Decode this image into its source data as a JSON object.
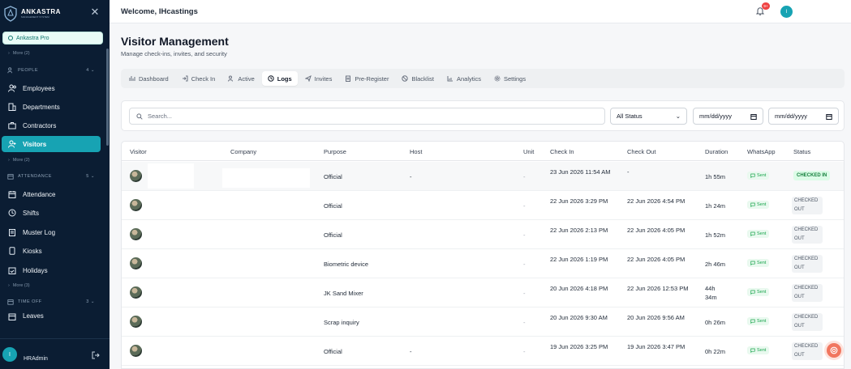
{
  "sidebar": {
    "brand": "ANKASTRA",
    "brand_tagline": "MANAGEMENT SYSTEM",
    "plan": "Ankastra Pro",
    "more_top": "More (2)",
    "people": {
      "label": "PEOPLE",
      "count": "4"
    },
    "people_items": [
      "Employees",
      "Departments",
      "Contractors",
      "Visitors"
    ],
    "more_people": "More (2)",
    "attendance": {
      "label": "ATTENDANCE",
      "count": "5"
    },
    "attendance_items": [
      "Attendance",
      "Shifts",
      "Muster Log",
      "Kiosks",
      "Holidays"
    ],
    "more_attendance": "More (3)",
    "time_off": {
      "label": "TIME OFF",
      "count": "3"
    },
    "time_off_items": [
      "Leaves"
    ],
    "user": {
      "initial": "I",
      "name": "HRAdmin"
    }
  },
  "topbar": {
    "welcome": "Welcome, IHcastings",
    "notif_badge": "9+",
    "avatar_initial": "I"
  },
  "page": {
    "title": "Visitor Management",
    "subtitle": "Manage check-ins, invites, and security"
  },
  "tabs": [
    "Dashboard",
    "Check In",
    "Active",
    "Logs",
    "Invites",
    "Pre-Register",
    "Blacklist",
    "Analytics",
    "Settings"
  ],
  "filters": {
    "search_placeholder": "Search...",
    "status_value": "All Status",
    "date_from": "mm/dd/yyyy",
    "date_to": "mm/dd/yyyy"
  },
  "table": {
    "headers": [
      "Visitor",
      "Company",
      "Purpose",
      "Host",
      "Unit",
      "Check In",
      "Check Out",
      "Duration",
      "WhatsApp",
      "Status"
    ],
    "rows": [
      {
        "purpose": "Official",
        "host": "-",
        "unit": "-",
        "check_in": "23 Jun 2026 11:54 AM",
        "check_out": "-",
        "duration": "1h 55m",
        "whatsapp": "Sent",
        "status": "CHECKED IN"
      },
      {
        "purpose": "Official",
        "host": "",
        "unit": "-",
        "check_in": "22 Jun 2026 3:29 PM",
        "check_out": "22 Jun 2026 4:54 PM",
        "duration": "1h 24m",
        "whatsapp": "Sent",
        "status": "CHECKED OUT"
      },
      {
        "purpose": "Official",
        "host": "",
        "unit": "-",
        "check_in": "22 Jun 2026 2:13 PM",
        "check_out": "22 Jun 2026 4:05 PM",
        "duration": "1h 52m",
        "whatsapp": "Sent",
        "status": "CHECKED OUT"
      },
      {
        "purpose": "Biometric device",
        "host": "",
        "unit": "-",
        "check_in": "22 Jun 2026 1:19 PM",
        "check_out": "22 Jun 2026 4:05 PM",
        "duration": "2h 46m",
        "whatsapp": "Sent",
        "status": "CHECKED OUT"
      },
      {
        "purpose": "JK Sand Mixer",
        "host": "",
        "unit": "-",
        "check_in": "20 Jun 2026 4:18 PM",
        "check_out": "22 Jun 2026 12:53 PM",
        "duration": "44h 34m",
        "whatsapp": "Sent",
        "status": "CHECKED OUT"
      },
      {
        "purpose": "Scrap inquiry",
        "host": "",
        "unit": "-",
        "check_in": "20 Jun 2026 9:30 AM",
        "check_out": "20 Jun 2026 9:56 AM",
        "duration": "0h 26m",
        "whatsapp": "Sent",
        "status": "CHECKED OUT"
      },
      {
        "purpose": "Official",
        "host": "-",
        "unit": "-",
        "check_in": "19 Jun 2026 3:25 PM",
        "check_out": "19 Jun 2026 3:47 PM",
        "duration": "0h 22m",
        "whatsapp": "Sent",
        "status": "CHECKED OUT"
      }
    ]
  },
  "colors": {
    "sidebar_bg": "#0b1d33",
    "accent": "#17a3b3",
    "checked_in": "#15803d",
    "fab": "#f1765f"
  },
  "icons": [
    "close-icon",
    "bell-icon",
    "search-icon",
    "calendar-icon",
    "whatsapp-icon",
    "logout-icon",
    "help-fab-icon"
  ]
}
